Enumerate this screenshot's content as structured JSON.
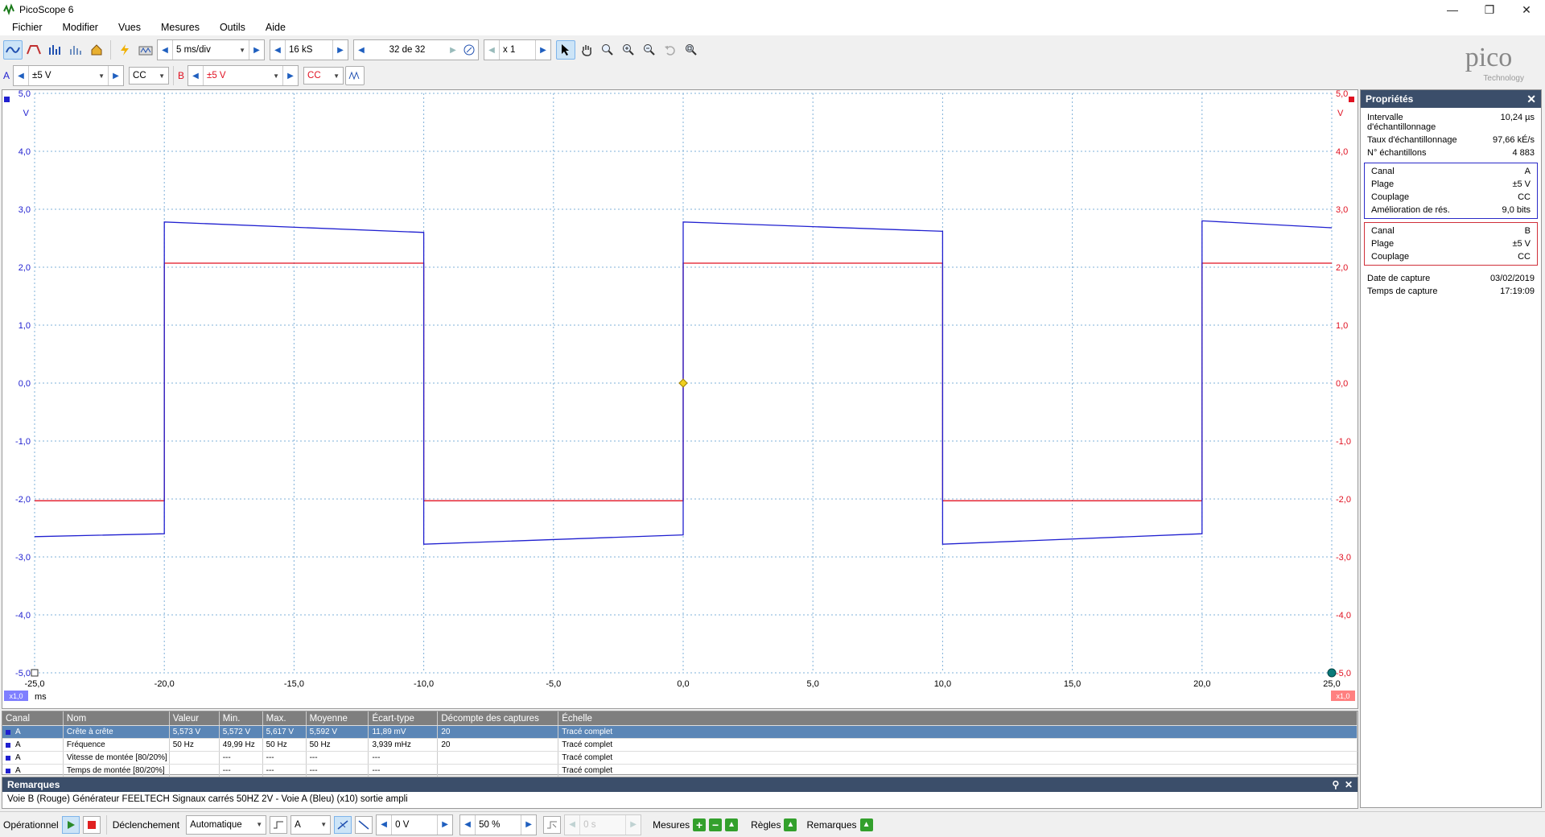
{
  "window": {
    "title": "PicoScope 6"
  },
  "menu": [
    "Fichier",
    "Modifier",
    "Vues",
    "Mesures",
    "Outils",
    "Aide"
  ],
  "toolbar": {
    "timebase": "5 ms/div",
    "samples": "16 kS",
    "capture_index": "32 de 32",
    "zoom": "x 1"
  },
  "channels": {
    "a_label": "A",
    "a_range": "±5 V",
    "a_coupling": "CC",
    "b_label": "B",
    "b_range": "±5 V",
    "b_coupling": "CC"
  },
  "logo": {
    "brand": "pico",
    "sub": "Technology"
  },
  "plot": {
    "x_unit": "ms",
    "y_unit_left": "V",
    "y_unit_right": "V",
    "x_scale_badge": "x1,0",
    "y_scale_badge_right": "x1,0",
    "colors": {
      "a": "#2020d0",
      "b": "#e01020",
      "grid": "#7fb0d8"
    }
  },
  "chart_data": {
    "type": "line",
    "title": "",
    "xlabel": "ms",
    "ylabel": "V",
    "xlim": [
      -25,
      25
    ],
    "ylim": [
      -5,
      5
    ],
    "x_ticks": [
      "-25,0",
      "-20,0",
      "-15,0",
      "-10,0",
      "-5,0",
      "0,0",
      "5,0",
      "10,0",
      "15,0",
      "20,0",
      "25,0"
    ],
    "y_ticks_left": [
      "5,0",
      "4,0",
      "3,0",
      "2,0",
      "1,0",
      "0,0",
      "-1,0",
      "-2,0",
      "-3,0",
      "-4,0",
      "-5,0"
    ],
    "y_ticks_right": [
      "5,0",
      "4,0",
      "3,0",
      "2,0",
      "1,0",
      "0,0",
      "-1,0",
      "-2,0",
      "-3,0",
      "-4,0",
      "-5,0"
    ],
    "series": [
      {
        "channel": "A",
        "x": [
          -25,
          -20,
          -20,
          -10,
          -10,
          0,
          0,
          10,
          10,
          20,
          20,
          25
        ],
        "y": [
          -2.65,
          -2.6,
          2.78,
          2.6,
          -2.78,
          -2.62,
          2.78,
          2.62,
          -2.78,
          -2.6,
          2.8,
          2.68
        ]
      },
      {
        "channel": "B",
        "x": [
          -25,
          -20,
          -20,
          -10,
          -10,
          0,
          0,
          10,
          10,
          20,
          20,
          25
        ],
        "y": [
          -2.03,
          -2.03,
          2.07,
          2.07,
          -2.03,
          -2.03,
          2.07,
          2.07,
          -2.03,
          -2.03,
          2.07,
          2.07
        ]
      }
    ],
    "grid": true
  },
  "properties": {
    "title": "Propriétés",
    "general": [
      {
        "k": "Intervalle d'échantillonnage",
        "v": "10,24 µs"
      },
      {
        "k": "Taux d'échantillonnage",
        "v": "97,66 kÉ/s"
      },
      {
        "k": "N° échantillons",
        "v": "4 883"
      }
    ],
    "channel_a": [
      {
        "k": "Canal",
        "v": "A"
      },
      {
        "k": "Plage",
        "v": "±5 V"
      },
      {
        "k": "Couplage",
        "v": "CC"
      },
      {
        "k": "Amélioration de rés.",
        "v": "9,0 bits"
      }
    ],
    "channel_b": [
      {
        "k": "Canal",
        "v": "B"
      },
      {
        "k": "Plage",
        "v": "±5 V"
      },
      {
        "k": "Couplage",
        "v": "CC"
      }
    ],
    "capture": [
      {
        "k": "Date de capture",
        "v": "03/02/2019"
      },
      {
        "k": "Temps de capture",
        "v": "17:19:09"
      }
    ]
  },
  "measurements": {
    "headers": [
      "Canal",
      "Nom",
      "Valeur",
      "Min.",
      "Max.",
      "Moyenne",
      "Écart-type",
      "Décompte des captures",
      "Échelle"
    ],
    "rows": [
      [
        "A",
        "Crête à crête",
        "5,573 V",
        "5,572 V",
        "5,617 V",
        "5,592 V",
        "11,89 mV",
        "20",
        "Tracé complet"
      ],
      [
        "A",
        "Fréquence",
        "50 Hz",
        "49,99 Hz",
        "50 Hz",
        "50 Hz",
        "3,939 mHz",
        "20",
        "Tracé complet"
      ],
      [
        "A",
        "Vitesse de montée  [80/20%]",
        "",
        "---",
        "---",
        "---",
        "---",
        "",
        "Tracé complet"
      ],
      [
        "A",
        "Temps de montée  [80/20%]",
        "",
        "---",
        "---",
        "---",
        "---",
        "",
        "Tracé complet"
      ]
    ]
  },
  "remarks": {
    "title": "Remarques",
    "text": "Voie B (Rouge) Générateur FEELTECH Signaux carrés 50HZ 2V - Voie A (Bleu) (x10) sortie ampli"
  },
  "status": {
    "mode": "Opérationnel",
    "trigger_label": "Déclenchement",
    "trigger_mode": "Automatique",
    "trigger_channel": "A",
    "trigger_level": "0 V",
    "pretrigger": "50 %",
    "delay": "0 s",
    "measures": "Mesures",
    "rules": "Règles",
    "remarks": "Remarques"
  }
}
